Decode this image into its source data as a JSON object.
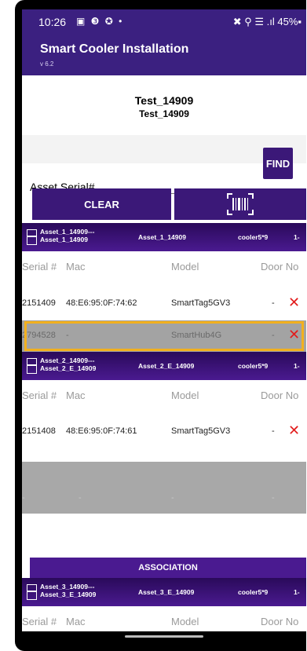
{
  "status_bar": {
    "time": "10:26",
    "left_icons": "▣ ❸ ✪ •",
    "right_info": "✖ ⚲ ☰ .ıl 45%▪"
  },
  "app": {
    "title": "Smart Cooler Installation",
    "version": "v 6.2"
  },
  "test": {
    "line1": "Test_14909",
    "line2": "Test_14909"
  },
  "search": {
    "label": "Asset Serial#",
    "value": "",
    "find_label": "FIND"
  },
  "actions": {
    "clear_label": "CLEAR",
    "scan_icon": "barcode-scan-icon"
  },
  "columns": {
    "serial": "Serial #",
    "mac": "Mac",
    "model": "Model",
    "door": "Door No"
  },
  "assets": [
    {
      "name": "Asset_1_14909---Asset_1_14909",
      "id": "Asset_1_14909",
      "cooler": "cooler5*9",
      "more": "1-",
      "rows": [
        {
          "serial": "2151409",
          "mac": "48:E6:95:0F:74:62",
          "model": "SmartTag5GV3",
          "door": "-"
        },
        {
          "serial": "2794528",
          "mac": "-",
          "model": "SmartHub4G",
          "door": "-"
        }
      ]
    },
    {
      "name": "Asset_2_14909---Asset_2_E_14909",
      "id": "Asset_2_E_14909",
      "cooler": "cooler5*9",
      "more": "1-",
      "rows": [
        {
          "serial": "2151408",
          "mac": "48:E6:95:0F:74:61",
          "model": "SmartTag5GV3",
          "door": "-"
        },
        {
          "serial": "-",
          "mac": "-",
          "model": "-",
          "door": "-"
        }
      ]
    },
    {
      "name": "Asset_3_14909---Asset_3_E_14909",
      "id": "Asset_3_E_14909",
      "cooler": "cooler5*9",
      "more": "1-"
    }
  ],
  "association_label": "ASSOCIATION",
  "remove_symbol": "✕",
  "colors": {
    "primary": "#3b1878",
    "highlight": "#f2b01e",
    "remove": "#e21c1c"
  }
}
